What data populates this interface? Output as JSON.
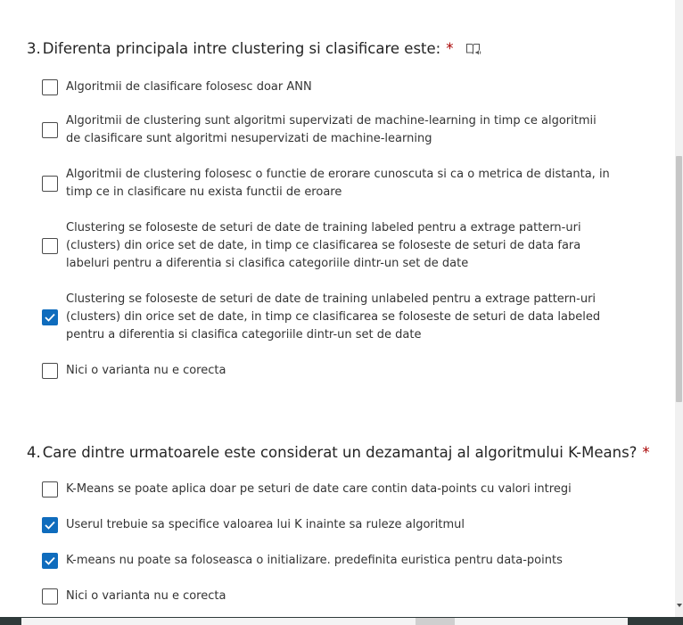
{
  "questions": [
    {
      "number": "3.",
      "title": "Diferenta principala intre clustering si clasificare este:",
      "required_mark": "*",
      "reader_icon": "immersive-reader-icon",
      "options": [
        {
          "label": "Algoritmii de clasificare folosesc doar ANN",
          "checked": false
        },
        {
          "label": "Algoritmii de clustering sunt algoritmi supervizati de machine-learning in timp ce algoritmii de clasificare sunt algoritmi nesupervizati de machine-learning",
          "checked": false
        },
        {
          "label": "Algoritmii de clustering folosesc o functie de erorare cunoscuta si ca o metrica de distanta, in timp ce in clasificare nu exista functii de eroare",
          "checked": false
        },
        {
          "label": "Clustering se foloseste de seturi de date de training labeled pentru a extrage pattern-uri (clusters) din orice set de date, in timp ce clasificarea se foloseste de seturi de data fara labeluri pentru a diferentia si clasifica categoriile dintr-un set de date",
          "checked": false
        },
        {
          "label": "Clustering se foloseste de seturi de date de training unlabeled pentru a extrage pattern-uri (clusters) din orice set de date, in timp ce clasificarea se foloseste de seturi de data labeled pentru a diferentia si clasifica categoriile dintr-un set de date",
          "checked": true
        },
        {
          "label": "Nici o varianta nu e corecta",
          "checked": false
        }
      ]
    },
    {
      "number": "4.",
      "title": "Care dintre urmatoarele este considerat un dezamantaj al algoritmului K-Means?",
      "required_mark": "*",
      "options": [
        {
          "label": "K-Means se poate aplica doar pe seturi de date care contin data-points cu valori intregi",
          "checked": false
        },
        {
          "label": "Userul trebuie sa specifice valoarea lui K inainte sa ruleze algoritmul",
          "checked": true
        },
        {
          "label": "K-means nu poate sa foloseasca o initializare. predefinita euristica pentru data-points",
          "checked": true
        },
        {
          "label": "Nici o varianta nu e corecta",
          "checked": false
        }
      ]
    }
  ],
  "colors": {
    "accent": "#0f6cbd",
    "required": "#a80000",
    "text": "#333333"
  }
}
